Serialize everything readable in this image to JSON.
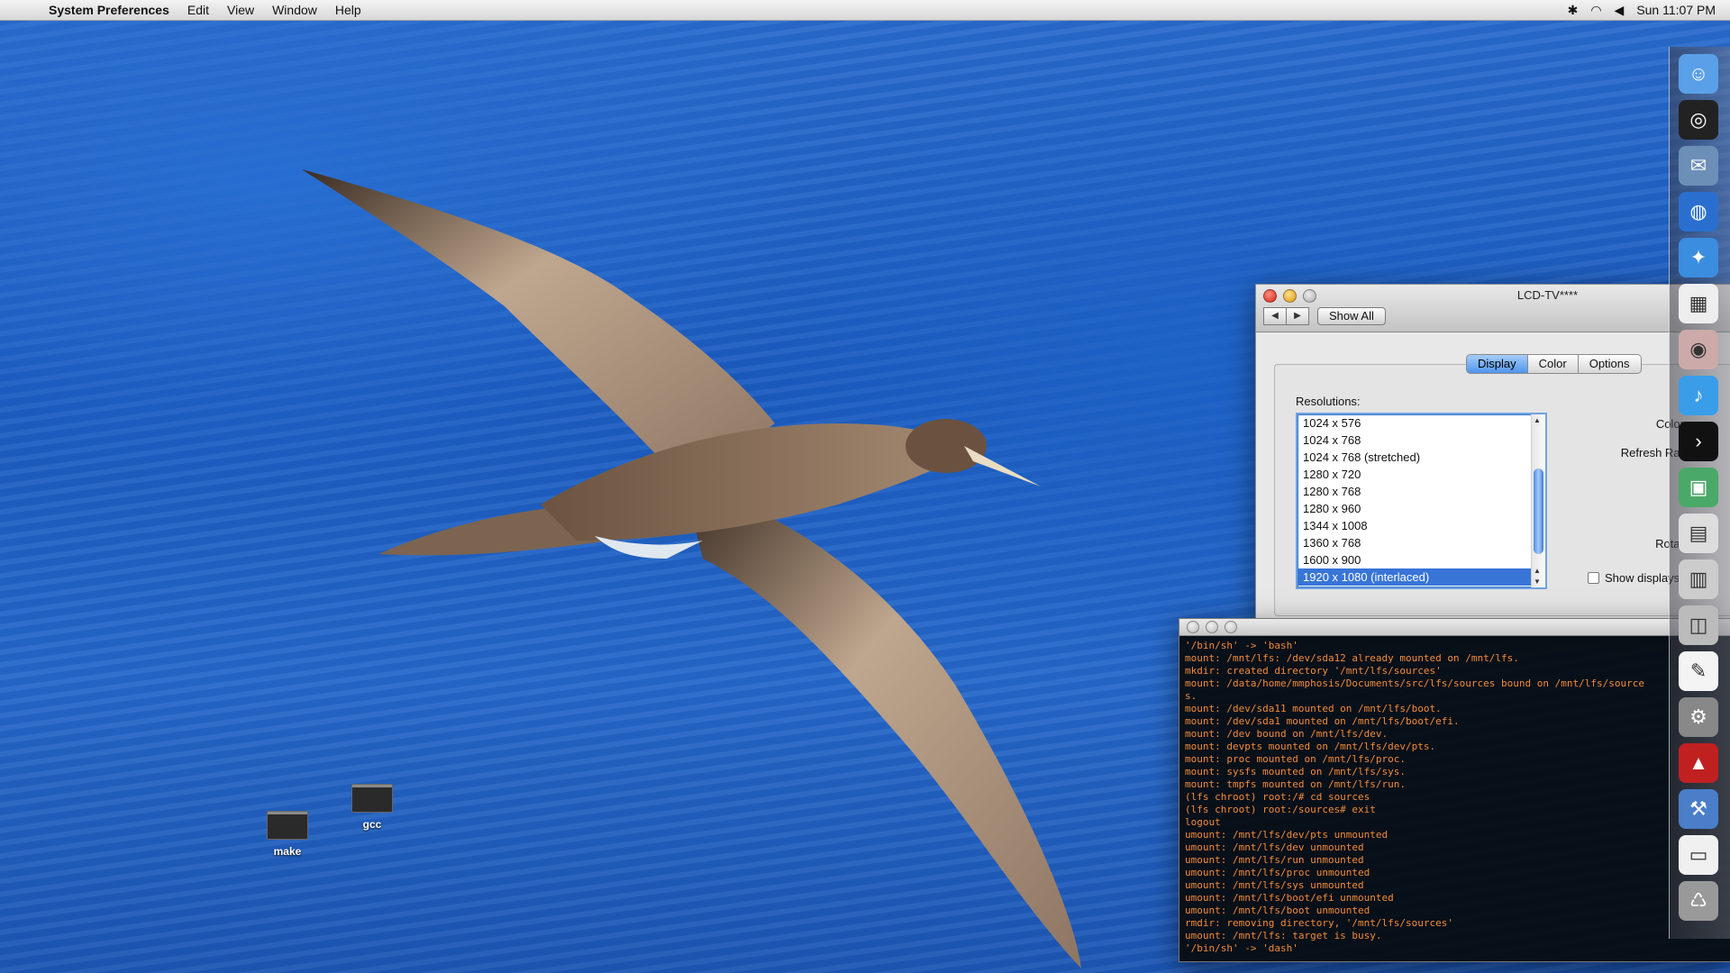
{
  "menubar": {
    "apple_icon": "apple-icon",
    "app_name": "System Preferences",
    "items": [
      "Edit",
      "View",
      "Window",
      "Help"
    ],
    "clock": "Sun 11:07 PM",
    "status_icons": [
      "bluetooth-icon",
      "wifi-icon",
      "volume-icon"
    ]
  },
  "desktop": {
    "icons": [
      {
        "label": "make",
        "icon": "terminal-document-icon"
      },
      {
        "label": "gcc",
        "icon": "terminal-document-icon"
      }
    ]
  },
  "prefs_window": {
    "title": "LCD-TV****",
    "show_all": "Show All",
    "back_icon": "back-arrow-icon",
    "forward_icon": "forward-arrow-icon",
    "tabs": [
      {
        "label": "Display",
        "active": true
      },
      {
        "label": "Color",
        "active": false
      },
      {
        "label": "Options",
        "active": false
      }
    ],
    "resolutions_label": "Resolutions:",
    "resolutions": [
      "1024 x 576",
      "1024 x 768",
      "1024 x 768 (stretched)",
      "1280 x 720",
      "1280 x 768",
      "1280 x 960",
      "1344 x 1008",
      "1360 x 768",
      "1600 x 900",
      "1920 x 1080 (interlaced)"
    ],
    "selected_resolution": "1920 x 1080 (interlaced)",
    "colors_label": "Colors:",
    "refresh_label": "Refresh Rate:",
    "rotate_label": "Rotate:",
    "show_displays_label": "Show displays"
  },
  "terminal": {
    "lines": [
      "'/bin/sh' -> 'bash'",
      "mount: /mnt/lfs: /dev/sda12 already mounted on /mnt/lfs.",
      "mkdir: created directory '/mnt/lfs/sources'",
      "mount: /data/home/mmphosis/Documents/src/lfs/sources bound on /mnt/lfs/source",
      "s.",
      "mount: /dev/sda11 mounted on /mnt/lfs/boot.",
      "mount: /dev/sda1 mounted on /mnt/lfs/boot/efi.",
      "mount: /dev bound on /mnt/lfs/dev.",
      "mount: devpts mounted on /mnt/lfs/dev/pts.",
      "mount: proc mounted on /mnt/lfs/proc.",
      "mount: sysfs mounted on /mnt/lfs/sys.",
      "mount: tmpfs mounted on /mnt/lfs/run.",
      "(lfs chroot) root:/# cd sources",
      "(lfs chroot) root:/sources# exit",
      "logout",
      "umount: /mnt/lfs/dev/pts unmounted",
      "umount: /mnt/lfs/dev unmounted",
      "umount: /mnt/lfs/run unmounted",
      "umount: /mnt/lfs/proc unmounted",
      "umount: /mnt/lfs/sys unmounted",
      "umount: /mnt/lfs/boot/efi unmounted",
      "umount: /mnt/lfs/boot unmounted",
      "rmdir: removing directory, '/mnt/lfs/sources'",
      "umount: /mnt/lfs: target is busy.",
      "'/bin/sh' -> 'dash'"
    ],
    "text_color": "#f28b3a"
  },
  "dock": {
    "icons": [
      "finder-icon",
      "dashboard-icon",
      "mail-icon",
      "browser-globe-icon",
      "safari-icon",
      "calendar-icon",
      "photo-booth-icon",
      "itunes-icon",
      "terminal-icon",
      "preview-icon",
      "printer-icon",
      "scanner-icon",
      "camera-icon",
      "textedit-icon",
      "system-preferences-icon",
      "chair-icon",
      "xcode-icon",
      "document-icon",
      "trash-icon"
    ]
  }
}
